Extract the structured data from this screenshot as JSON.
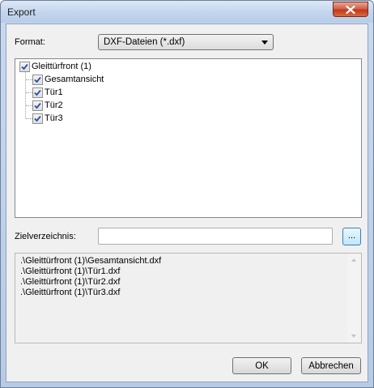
{
  "window": {
    "title": "Export"
  },
  "format": {
    "label": "Format:",
    "selected": "DXF-Dateien (*.dxf)"
  },
  "tree": {
    "root": {
      "label": "Gleittürfront (1)",
      "checked": true
    },
    "children": [
      {
        "label": "Gesamtansicht",
        "checked": true
      },
      {
        "label": "Tür1",
        "checked": true
      },
      {
        "label": "Tür2",
        "checked": true
      },
      {
        "label": "Tür3",
        "checked": true
      }
    ]
  },
  "target_dir": {
    "label": "Zielverzeichnis:",
    "value": "",
    "browse_label": "..."
  },
  "files": [
    ".\\Gleittürfront (1)\\Gesamtansicht.dxf",
    ".\\Gleittürfront (1)\\Tür1.dxf",
    ".\\Gleittürfront (1)\\Tür2.dxf",
    ".\\Gleittürfront (1)\\Tür3.dxf"
  ],
  "buttons": {
    "ok": "OK",
    "cancel": "Abbrechen"
  },
  "icons": {
    "close": "close-icon",
    "checkbox": "checkmark-icon"
  },
  "colors": {
    "close_button": "#c0391e",
    "title_bar": "#c4d6ee",
    "checkmark": "#2a4fa0"
  }
}
